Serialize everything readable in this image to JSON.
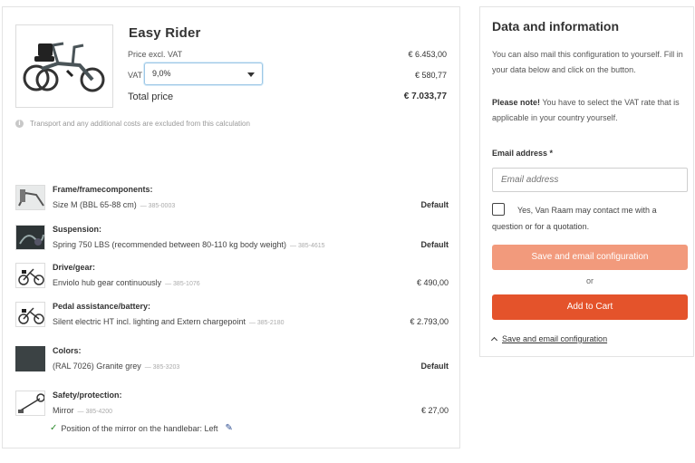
{
  "product": {
    "title": "Easy Rider",
    "price_excl_label": "Price excl. VAT",
    "price_excl_value": "€ 6.453,00",
    "vat_label": "VAT",
    "vat_selected": "9,0%",
    "vat_value": "€ 580,77",
    "total_label": "Total price",
    "total_value": "€ 7.033,77",
    "notice": "Transport and any additional costs are excluded from this calculation"
  },
  "components": [
    {
      "category": "Frame/framecomponents:",
      "description": "Size M (BBL 65-88 cm)",
      "code": "— 385-0003",
      "price": "Default"
    },
    {
      "category": "Suspension:",
      "description": "Spring 750 LBS (recommended between 80-110 kg body weight)",
      "code": "— 385-4615",
      "price": "Default"
    },
    {
      "category": "Drive/gear:",
      "description": "Enviolo hub gear continuously",
      "code": "— 385-1076",
      "price": "€ 490,00"
    },
    {
      "category": "Pedal assistance/battery:",
      "description": "Silent electric HT incl. lighting and Extern chargepoint",
      "code": "— 385-2180",
      "price": "€ 2.793,00"
    },
    {
      "category": "Colors:",
      "description": "(RAL 7026) Granite grey",
      "code": "— 385-3203",
      "price": "Default"
    },
    {
      "category": "Safety/protection:",
      "description": "Mirror",
      "code": "— 385-4200",
      "price": "€ 27,00"
    }
  ],
  "mirror_note": "Position of the mirror on the handlebar: Left",
  "info_panel": {
    "title": "Data and information",
    "intro": "You can also mail this configuration to yourself. Fill in your data below and click on the button.",
    "note_bold": "Please note!",
    "note_text": " You have to select the VAT rate that is applicable in your country yourself.",
    "email_label": "Email address *",
    "email_placeholder": "Email address",
    "consent": "Yes, Van Raam may contact me with a question or for a quotation.",
    "save_button": "Save and email configuration",
    "or": "or",
    "cart_button": "Add to Cart",
    "save_link": "Save and email configuration"
  },
  "colors": {
    "save_button": "#f29a7c",
    "cart_button": "#e4532b",
    "frame_grey": "#4a5458",
    "swatch_granite": "#3b4244"
  },
  "icons": {
    "notice": "info-icon",
    "check": "check-icon",
    "edit": "pencil-icon",
    "collapse": "chevron-up-icon"
  }
}
